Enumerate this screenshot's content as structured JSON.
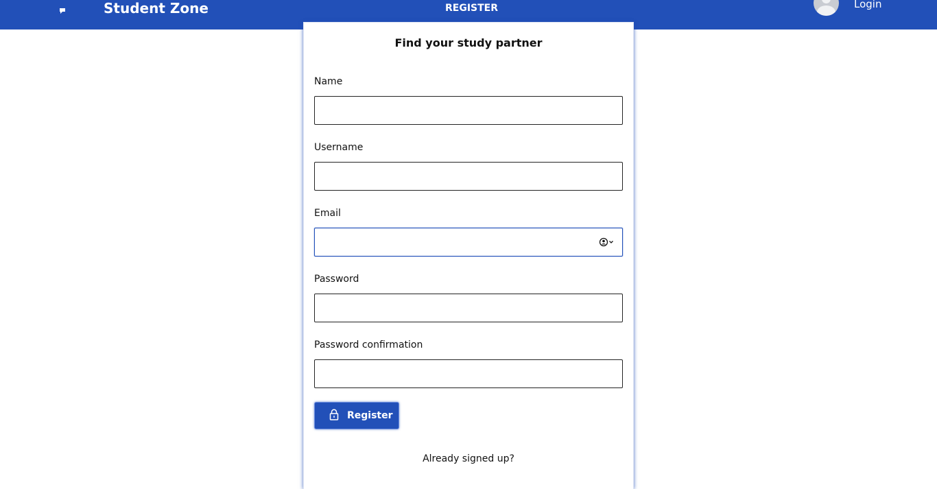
{
  "header": {
    "brand_icon": "chat-bubble-icon",
    "brand_title": "Student Zone",
    "nav_register": "REGISTER",
    "avatar_icon": "user-avatar-icon",
    "nav_login": "Login",
    "background_color": "#2250b8"
  },
  "form": {
    "title": "Find your study partner",
    "fields": [
      {
        "label": "Name",
        "value": ""
      },
      {
        "label": "Username",
        "value": ""
      },
      {
        "label": "Email",
        "value": "",
        "autofill_icon": "contact-autofill-icon"
      },
      {
        "label": "Password",
        "value": ""
      },
      {
        "label": "Password confirmation",
        "value": ""
      }
    ],
    "submit_label": "Register",
    "submit_icon": "lock-icon",
    "already_signed_up": "Already signed up?"
  },
  "colors": {
    "accent": "#2250b8",
    "focus_border": "#2250b8"
  }
}
